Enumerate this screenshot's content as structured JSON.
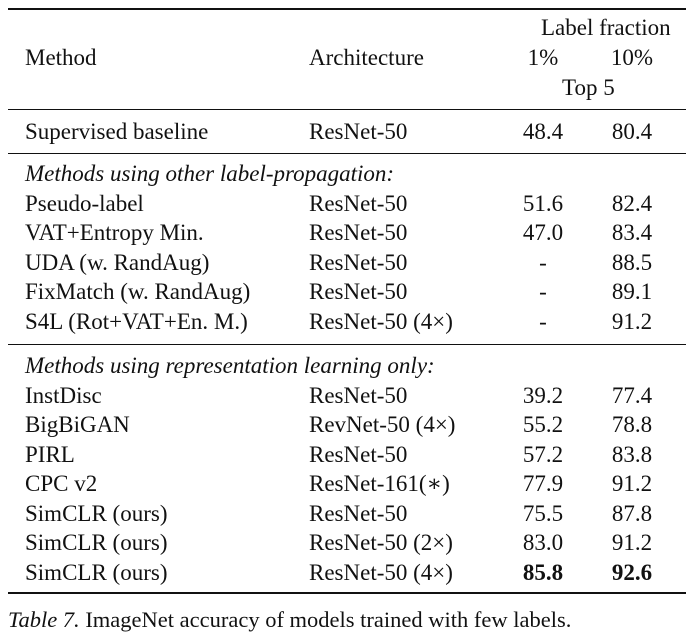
{
  "table": {
    "header": {
      "method": "Method",
      "architecture": "Architecture",
      "label_fraction": "Label fraction",
      "col_1pct": "1%",
      "col_10pct": "10%",
      "metric": "Top 5"
    },
    "baseline": {
      "method": "Supervised baseline",
      "architecture": "ResNet-50",
      "top5_1pct": "48.4",
      "top5_10pct": "80.4"
    },
    "groups": [
      {
        "title": "Methods using other label-propagation:",
        "rows": [
          {
            "method": "Pseudo-label",
            "architecture": "ResNet-50",
            "top5_1pct": "51.6",
            "top5_10pct": "82.4"
          },
          {
            "method": "VAT+Entropy Min.",
            "architecture": "ResNet-50",
            "top5_1pct": "47.0",
            "top5_10pct": "83.4"
          },
          {
            "method": "UDA (w. RandAug)",
            "architecture": "ResNet-50",
            "top5_1pct": "-",
            "top5_10pct": "88.5"
          },
          {
            "method": "FixMatch (w. RandAug)",
            "architecture": "ResNet-50",
            "top5_1pct": "-",
            "top5_10pct": "89.1"
          },
          {
            "method": "S4L (Rot+VAT+En. M.)",
            "architecture": "ResNet-50 (4×)",
            "top5_1pct": "-",
            "top5_10pct": "91.2"
          }
        ]
      },
      {
        "title": "Methods using representation learning only:",
        "rows": [
          {
            "method": "InstDisc",
            "architecture": "ResNet-50",
            "top5_1pct": "39.2",
            "top5_10pct": "77.4"
          },
          {
            "method": "BigBiGAN",
            "architecture": "RevNet-50 (4×)",
            "top5_1pct": "55.2",
            "top5_10pct": "78.8"
          },
          {
            "method": "PIRL",
            "architecture": "ResNet-50",
            "top5_1pct": "57.2",
            "top5_10pct": "83.8"
          },
          {
            "method": "CPC v2",
            "architecture": "ResNet-161(∗)",
            "top5_1pct": "77.9",
            "top5_10pct": "91.2"
          },
          {
            "method": "SimCLR (ours)",
            "architecture": "ResNet-50",
            "top5_1pct": "75.5",
            "top5_10pct": "87.8"
          },
          {
            "method": "SimCLR (ours)",
            "architecture": "ResNet-50 (2×)",
            "top5_1pct": "83.0",
            "top5_10pct": "91.2"
          },
          {
            "method": "SimCLR (ours)",
            "architecture": "ResNet-50 (4×)",
            "top5_1pct": "85.8",
            "top5_10pct": "92.6",
            "bold": true
          }
        ]
      }
    ]
  },
  "caption": {
    "label": "Table 7.",
    "text": " ImageNet accuracy of models trained with few labels."
  }
}
